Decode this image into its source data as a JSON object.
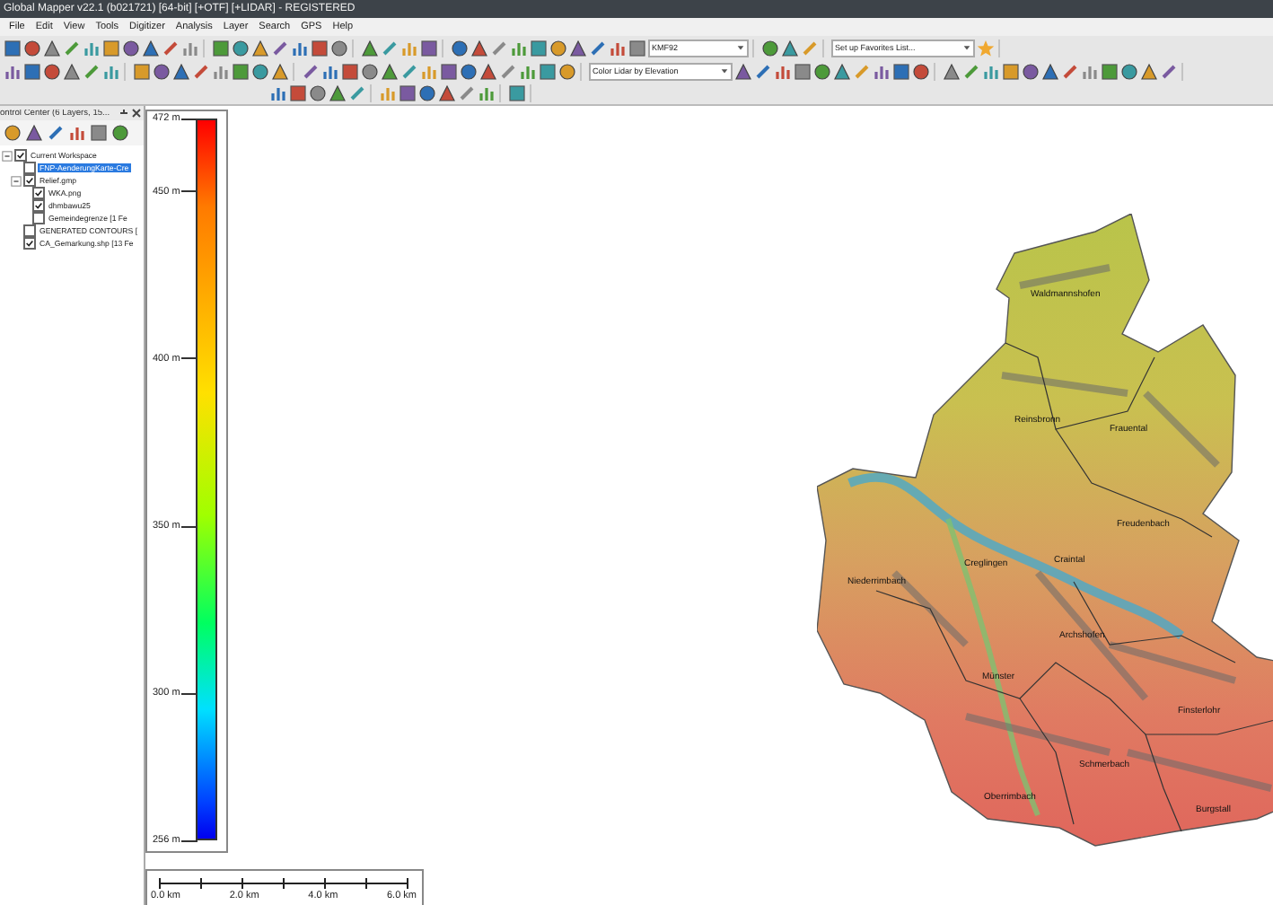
{
  "window": {
    "title": "Global Mapper v22.1 (b021721) [64-bit] [+OTF] [+LIDAR] - REGISTERED"
  },
  "menu": [
    "File",
    "Edit",
    "View",
    "Tools",
    "Digitizer",
    "Analysis",
    "Layer",
    "Search",
    "GPS",
    "Help"
  ],
  "toolbar_dropdowns": [
    {
      "value": "KMF92"
    },
    {
      "value": "Set up Favorites List..."
    },
    {
      "value": "Color Lidar by Elevation"
    }
  ],
  "control_center": {
    "title": "ontrol Center (6 Layers, 15...",
    "layers": [
      {
        "label": "Current Workspace",
        "checked": true,
        "selected": false,
        "expanded": true,
        "children": [
          {
            "label": "FNP-AenderungKarte-Cre",
            "checked": false,
            "selected": true
          },
          {
            "label": "Relief.gmp",
            "checked": true,
            "selected": false,
            "expanded": true,
            "children": [
              {
                "label": "WKA.png",
                "checked": true,
                "selected": false
              },
              {
                "label": "dhmbawu25",
                "checked": true,
                "selected": false
              },
              {
                "label": "Gemeindegrenze [1 Fe",
                "checked": false,
                "selected": false
              }
            ]
          },
          {
            "label": "GENERATED CONTOURS [",
            "checked": false,
            "selected": false
          },
          {
            "label": "CA_Gemarkung.shp [13 Fe",
            "checked": true,
            "selected": false
          }
        ]
      }
    ]
  },
  "elevation_legend": {
    "labels": [
      "472 m",
      "450 m",
      "400 m",
      "350 m",
      "300 m",
      "256 m"
    ]
  },
  "scale_bar": {
    "labels": [
      "0.0 km",
      "2.0 km",
      "4.0 km",
      "6.0 km"
    ]
  },
  "map": {
    "places": [
      "Waldmannshofen",
      "Reinsbronn",
      "Frauental",
      "Freudenbach",
      "Creglingen",
      "Craintal",
      "Niederrimbach",
      "Archshofen",
      "Münster",
      "Finsterlohr",
      "Schmerbach",
      "Oberrimbach",
      "Burgstall"
    ]
  }
}
